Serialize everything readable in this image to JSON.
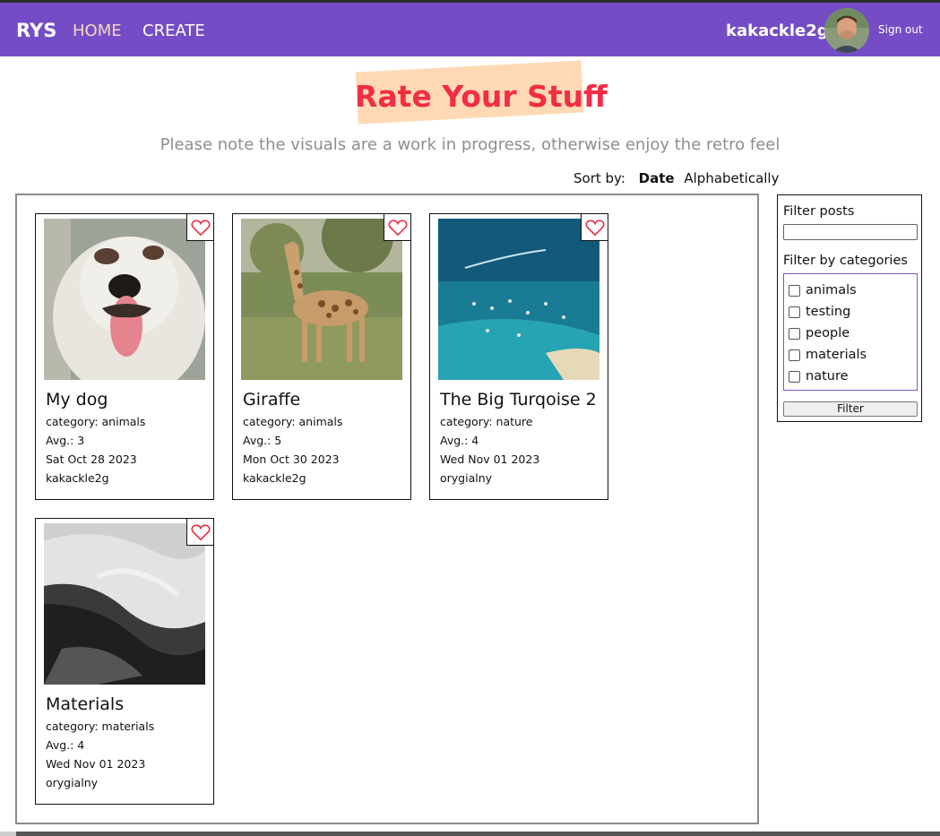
{
  "nav": {
    "brand": "RYS",
    "home": "HOME",
    "create": "CREATE",
    "username": "kakackle2g",
    "sign_out": "Sign out",
    "avatar_icon": "user-avatar-icon"
  },
  "header": {
    "title": "Rate Your Stuff",
    "subtitle": "Please note the visuals are a work in progress, otherwise enjoy the retro feel"
  },
  "sort": {
    "label": "Sort by:",
    "date": "Date",
    "alphabetical": "Alphabetically"
  },
  "posts": [
    {
      "title": "My dog",
      "category": "category: animals",
      "avg": "Avg.: 3",
      "date": "Sat Oct 28 2023",
      "author": "kakackle2g",
      "image": "dog-photo"
    },
    {
      "title": "Giraffe",
      "category": "category: animals",
      "avg": "Avg.: 5",
      "date": "Mon Oct 30 2023",
      "author": "kakackle2g",
      "image": "giraffe-photo"
    },
    {
      "title": "The Big Turqoise 2",
      "category": "category: nature",
      "avg": "Avg.: 4",
      "date": "Wed Nov 01 2023",
      "author": "orygialny",
      "image": "turquoise-sea-photo"
    },
    {
      "title": "Materials",
      "category": "category: materials",
      "avg": "Avg.: 4",
      "date": "Wed Nov 01 2023",
      "author": "orygialny",
      "image": "fabric-photo"
    }
  ],
  "filter": {
    "posts_label": "Filter posts",
    "search_value": "",
    "categories_label": "Filter by categories",
    "categories": [
      "animals",
      "testing",
      "people",
      "materials",
      "nature"
    ],
    "button": "Filter"
  },
  "colors": {
    "navbar": "#744dc6",
    "home_link": "#f7d7b9",
    "title": "#f22d45",
    "title_highlight": "#ffd9b5",
    "heart": "#e8324a"
  }
}
